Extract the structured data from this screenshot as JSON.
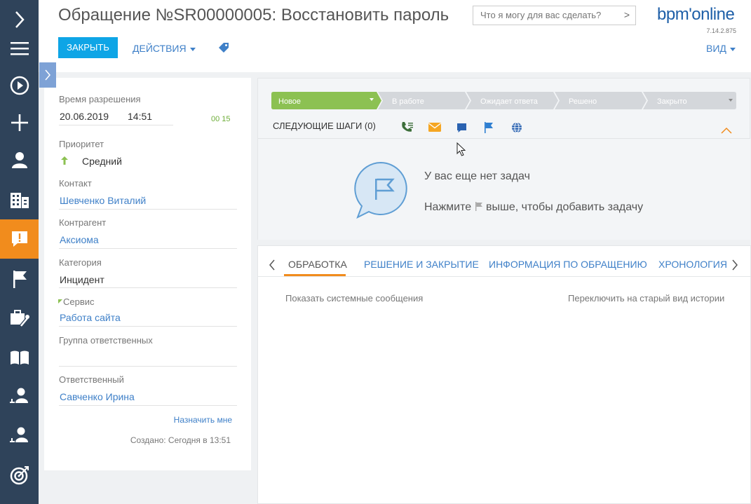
{
  "header": {
    "title": "Обращение №SR00000005: Восстановить пароль",
    "search_placeholder": "Что я могу для вас сделать?",
    "search_go": ">",
    "logo": "bpm'online",
    "version": "7.14.2.875",
    "close_label": "ЗАКРЫТЬ",
    "actions_label": "ДЕЙСТВИЯ",
    "view_label": "ВИД"
  },
  "nav": {
    "items": [
      {
        "icon": "chevron-right-icon"
      },
      {
        "icon": "hamburger-menu-icon"
      },
      {
        "icon": "play-circle-icon"
      },
      {
        "icon": "plus-icon"
      },
      {
        "icon": "contact-person-icon"
      },
      {
        "icon": "building-icon"
      },
      {
        "icon": "case-alert-icon",
        "active": true
      },
      {
        "icon": "flag-icon"
      },
      {
        "icon": "tools-briefcase-icon"
      },
      {
        "icon": "book-icon"
      },
      {
        "icon": "person-queue-icon"
      },
      {
        "icon": "person-queue-icon"
      },
      {
        "icon": "target-icon"
      }
    ],
    "active_color": "#f18c1d",
    "bg_color": "#2f435a"
  },
  "fields": {
    "resolution_time_label": "Время разрешения",
    "resolution_date": "20.06.2019",
    "resolution_time": "14:51",
    "timer": "00 15",
    "priority_label": "Приоритет",
    "priority_value": "Средний",
    "contact_label": "Контакт",
    "contact_value": "Шевченко Виталий",
    "account_label": "Контрагент",
    "account_value": "Аксиома",
    "category_label": "Категория",
    "category_value": "Инцидент",
    "service_label": "Сервис",
    "service_value": "Работа сайта",
    "group_label": "Группа ответственных",
    "group_value": "",
    "owner_label": "Ответственный",
    "owner_value": "Савченко Ирина",
    "assign_me": "Назначить мне",
    "created": "Создано: Сегодня в 13:51"
  },
  "stages": [
    {
      "label": "Новое",
      "active": true
    },
    {
      "label": "В работе",
      "active": false
    },
    {
      "label": "Ожидает ответа",
      "active": false
    },
    {
      "label": "Решено",
      "active": false
    },
    {
      "label": "Закрыто",
      "active": false
    }
  ],
  "next_steps": {
    "label": "СЛЕДУЮЩИЕ ШАГИ (0)",
    "tools": [
      "phone-call-icon",
      "email-icon",
      "chat-icon",
      "flag-icon",
      "globe-icon"
    ],
    "empty_title": "У вас еще нет задач",
    "empty_hint_before": "Нажмите",
    "empty_hint_after": "выше, чтобы добавить задачу"
  },
  "tabs": {
    "items": [
      {
        "label": "ОБРАБОТКА",
        "active": true
      },
      {
        "label": "РЕШЕНИЕ И ЗАКРЫТИЕ",
        "active": false
      },
      {
        "label": "ИНФОРМАЦИЯ ПО ОБРАЩЕНИЮ",
        "active": false
      },
      {
        "label": "ХРОНОЛОГИЯ",
        "active": false
      }
    ],
    "show_system": "Показать системные сообщения",
    "old_view": "Переключить на старый вид истории"
  },
  "colors": {
    "accent_orange": "#f18c1d",
    "stage_active": "#8cc152",
    "stage_inactive": "#d4d7db",
    "link_blue": "#3f80c8",
    "button_blue": "#0ea5e6"
  }
}
